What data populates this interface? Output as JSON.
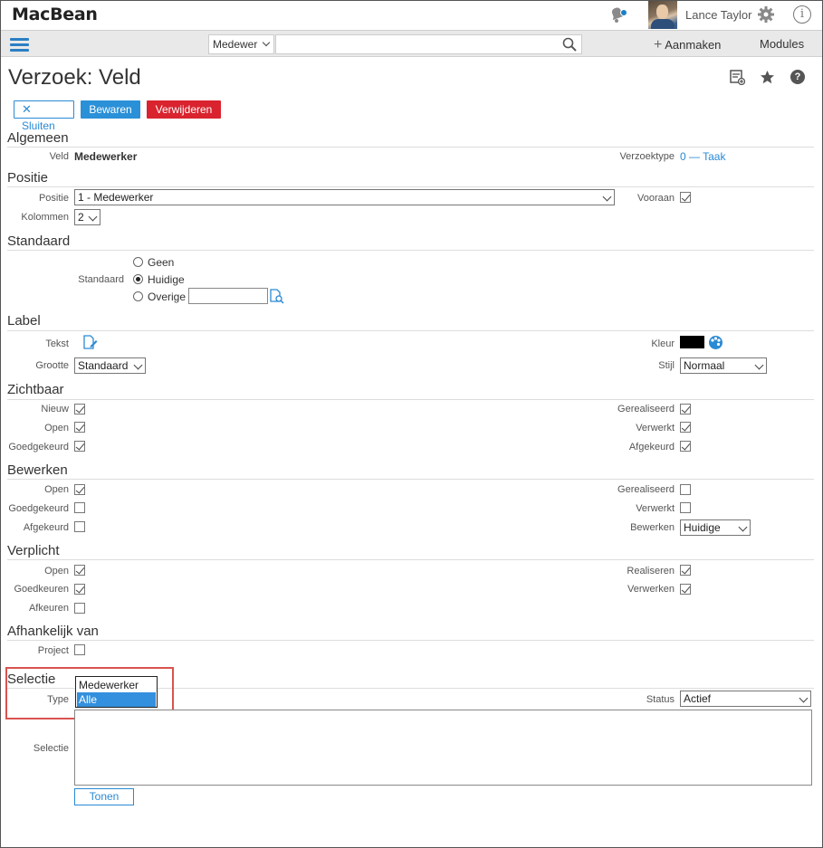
{
  "app": {
    "logo": "MacBean",
    "user": "Lance Taylor"
  },
  "nav": {
    "search_scope": "Medewer",
    "add": "Aanmaken",
    "modules": "Modules"
  },
  "page": {
    "title": "Verzoek: Veld"
  },
  "buttons": {
    "close": "Sluiten",
    "save": "Bewaren",
    "delete": "Verwijderen",
    "show": "Tonen"
  },
  "algemeen": {
    "title": "Algemeen",
    "veld_label": "Veld",
    "veld_value": "Medewerker",
    "type_label": "Verzoektype",
    "type_value": "0 — Taak"
  },
  "positie": {
    "title": "Positie",
    "positie_label": "Positie",
    "positie_value": "1 - Medewerker",
    "kolommen_label": "Kolommen",
    "kolommen_value": "2",
    "vooraan_label": "Vooraan"
  },
  "standaard": {
    "title": "Standaard",
    "label": "Standaard",
    "options": [
      "Geen",
      "Huidige",
      "Overige"
    ]
  },
  "labelsec": {
    "title": "Label",
    "tekst": "Tekst",
    "kleur": "Kleur",
    "grootte": "Grootte",
    "grootte_value": "Standaard",
    "stijl": "Stijl",
    "stijl_value": "Normaal"
  },
  "zichtbaar": {
    "title": "Zichtbaar",
    "left": [
      "Nieuw",
      "Open",
      "Goedgekeurd"
    ],
    "right": [
      "Gerealiseerd",
      "Verwerkt",
      "Afgekeurd"
    ]
  },
  "bewerken": {
    "title": "Bewerken",
    "left": [
      "Open",
      "Goedgekeurd",
      "Afgekeurd"
    ],
    "right": [
      "Gerealiseerd",
      "Verwerkt"
    ],
    "bewerken_label": "Bewerken",
    "bewerken_value": "Huidige"
  },
  "verplicht": {
    "title": "Verplicht",
    "left": [
      "Open",
      "Goedkeuren",
      "Afkeuren"
    ],
    "right": [
      "Realiseren",
      "Verwerken"
    ]
  },
  "afhankelijk": {
    "title": "Afhankelijk van",
    "project": "Project"
  },
  "selectie": {
    "title": "Selectie",
    "type_label": "Type",
    "type_options": [
      "Medewerker",
      "Alle"
    ],
    "status_label": "Status",
    "status_value": "Actief",
    "selectie_label": "Selectie"
  }
}
